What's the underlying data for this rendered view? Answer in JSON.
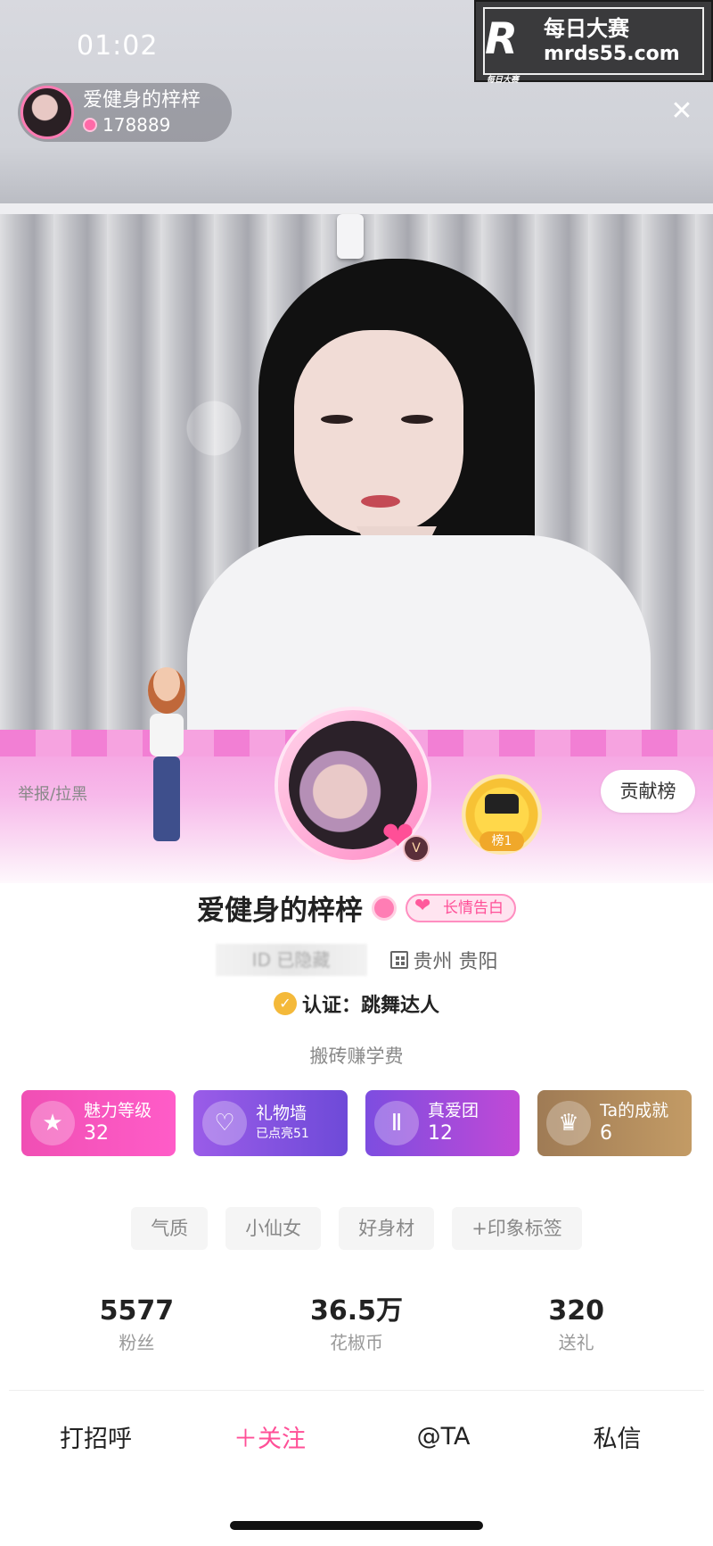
{
  "status_bar": {
    "time": "01:02"
  },
  "host": {
    "name": "爱健身的梓梓",
    "count": "178889"
  },
  "watermark": {
    "logo": "R",
    "logo_sub": "每日大赛",
    "line1": "每日大赛",
    "line2": "mrds55.com"
  },
  "profile": {
    "report_label": "举报/拉黑",
    "contrib_label": "贡献榜",
    "rank_label": "榜1",
    "name": "爱健身的梓梓",
    "confession_tag": "长情告白",
    "blurred_id": "ID 已隐藏",
    "location": "贵州 贵阳",
    "verify_text": "认证：跳舞达人",
    "bio": "搬砖赚学费"
  },
  "feature_cards": [
    {
      "icon": "star-icon",
      "title": "魅力等级",
      "value": "32"
    },
    {
      "icon": "heart-icon",
      "title": "礼物墙",
      "value": "已点亮51"
    },
    {
      "icon": "fan-group-icon",
      "title": "真爱团",
      "value": "12"
    },
    {
      "icon": "trophy-icon",
      "title": "Ta的成就",
      "value": "6"
    }
  ],
  "tags": [
    "气质",
    "小仙女",
    "好身材",
    "+印象标签"
  ],
  "stats": [
    {
      "value": "5577",
      "label": "粉丝"
    },
    {
      "value": "36.5万",
      "label": "花椒币"
    },
    {
      "value": "320",
      "label": "送礼"
    }
  ],
  "actions": {
    "greet": "打招呼",
    "follow": "＋关注",
    "mention": "@TA",
    "message": "私信"
  },
  "colors": {
    "accent": "#ff4f97",
    "card_pink": "#f59ee0"
  }
}
